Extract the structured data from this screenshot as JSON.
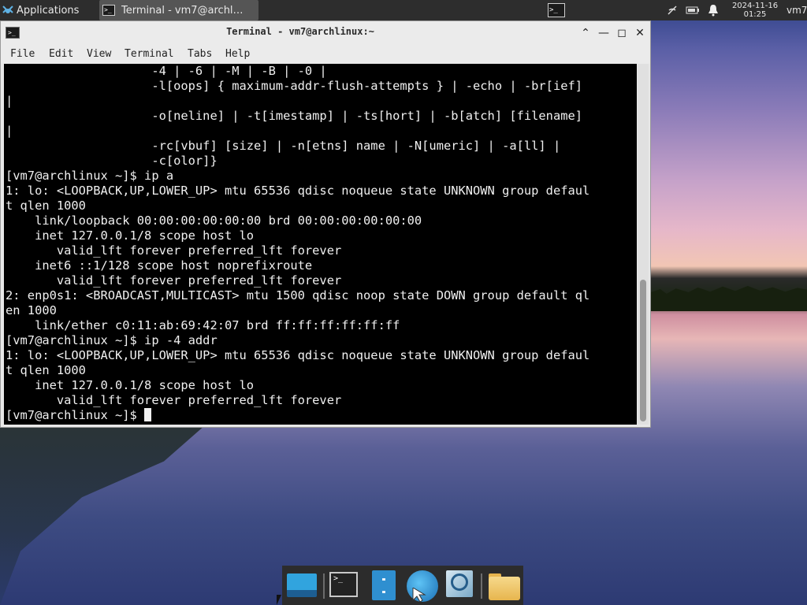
{
  "panel": {
    "apps_label": "Applications",
    "task_label": "Terminal - vm7@archl…",
    "clock_date": "2024-11-16",
    "clock_time": "01:25",
    "user": "vm7"
  },
  "window": {
    "title": "Terminal - vm7@archlinux:~",
    "icons": {
      "shade": "chevron-up-icon",
      "minimize": "minimize-icon",
      "maximize": "maximize-icon",
      "close": "close-icon"
    }
  },
  "menu": [
    "File",
    "Edit",
    "View",
    "Terminal",
    "Tabs",
    "Help"
  ],
  "terminal": {
    "lines": [
      "                    -4 | -6 | -M | -B | -0 |",
      "                    -l[oops] { maximum-addr-flush-attempts } | -echo | -br[ief]",
      "|",
      "                    -o[neline] | -t[imestamp] | -ts[hort] | -b[atch] [filename]",
      "|",
      "                    -rc[vbuf] [size] | -n[etns] name | -N[umeric] | -a[ll] |",
      "                    -c[olor]}",
      "[vm7@archlinux ~]$ ip a",
      "1: lo: <LOOPBACK,UP,LOWER_UP> mtu 65536 qdisc noqueue state UNKNOWN group defaul",
      "t qlen 1000",
      "    link/loopback 00:00:00:00:00:00 brd 00:00:00:00:00:00",
      "    inet 127.0.0.1/8 scope host lo",
      "       valid_lft forever preferred_lft forever",
      "    inet6 ::1/128 scope host noprefixroute",
      "       valid_lft forever preferred_lft forever",
      "2: enp0s1: <BROADCAST,MULTICAST> mtu 1500 qdisc noop state DOWN group default ql",
      "en 1000",
      "    link/ether c0:11:ab:69:42:07 brd ff:ff:ff:ff:ff:ff",
      "[vm7@archlinux ~]$ ip -4 addr",
      "1: lo: <LOOPBACK,UP,LOWER_UP> mtu 65536 qdisc noqueue state UNKNOWN group defaul",
      "t qlen 1000",
      "    inet 127.0.0.1/8 scope host lo",
      "       valid_lft forever preferred_lft forever"
    ],
    "prompt": "[vm7@archlinux ~]$ "
  },
  "dock": {
    "items": [
      "show-desktop-icon",
      "terminal-icon",
      "file-manager-icon",
      "web-browser-icon",
      "app-finder-icon",
      "home-folder-icon"
    ]
  },
  "colors": {
    "panel_bg": "#2d2d2d",
    "terminal_bg": "#000000",
    "terminal_fg": "#f0f0f0",
    "window_chrome": "#ebebeb"
  }
}
